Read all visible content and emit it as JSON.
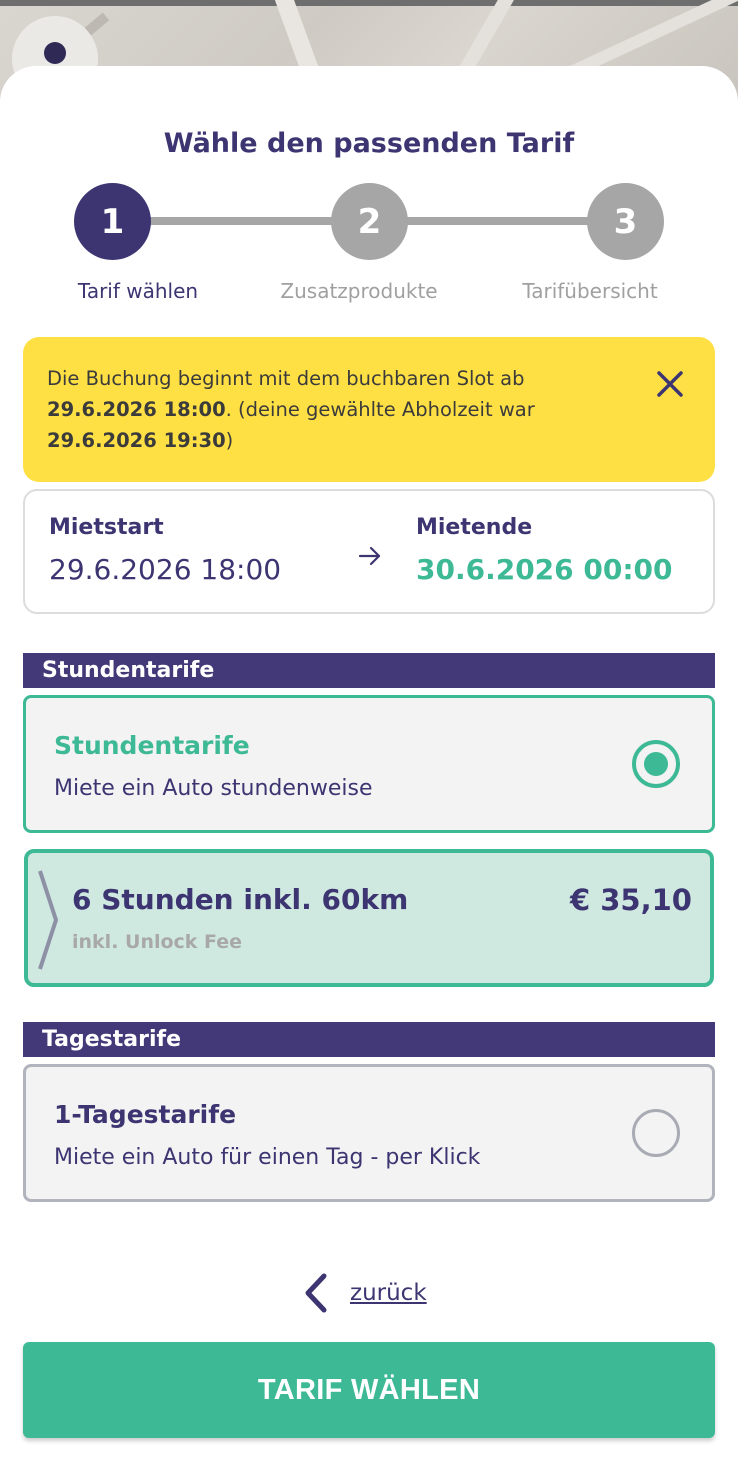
{
  "colors": {
    "primary": "#3c3572",
    "accent": "#3db995",
    "notice": "#ffe044",
    "section": "#433978",
    "inactive": "#a6a6a6"
  },
  "header": {
    "title": "Wähle den passenden Tarif"
  },
  "stepper": {
    "steps": [
      {
        "number": "1",
        "label": "Tarif wählen",
        "active": true
      },
      {
        "number": "2",
        "label": "Zusatzprodukte",
        "active": false
      },
      {
        "number": "3",
        "label": "Tarifübersicht",
        "active": false
      }
    ]
  },
  "notice": {
    "text1": "Die Buchung beginnt mit dem buchbaren Slot ab",
    "date_start": "29.6.2026 18:00",
    "text2": ". (deine gewählte Abholzeit war",
    "date_pickup": "29.6.2026 19:30",
    "text3": ")",
    "close_icon": "close-icon"
  },
  "period": {
    "start_label": "Mietstart",
    "start_value": "29.6.2026 18:00",
    "end_label": "Mietende",
    "end_value": "30.6.2026 00:00"
  },
  "sections": {
    "hourly": {
      "header": "Stundentarife",
      "option_title": "Stundentarife",
      "option_desc": "Miete ein Auto stundenweise",
      "selected": true,
      "tariff": {
        "title": "6 Stunden inkl. 60km",
        "price": "€ 35,10",
        "subtitle": "inkl. Unlock Fee"
      }
    },
    "daily": {
      "header": "Tagestarife",
      "option_title": "1-Tagestarife",
      "option_desc": "Miete ein Auto für einen Tag - per Klick",
      "selected": false
    }
  },
  "footer": {
    "back_label": "zurück",
    "cta_label": "TARIF WÄHLEN"
  }
}
